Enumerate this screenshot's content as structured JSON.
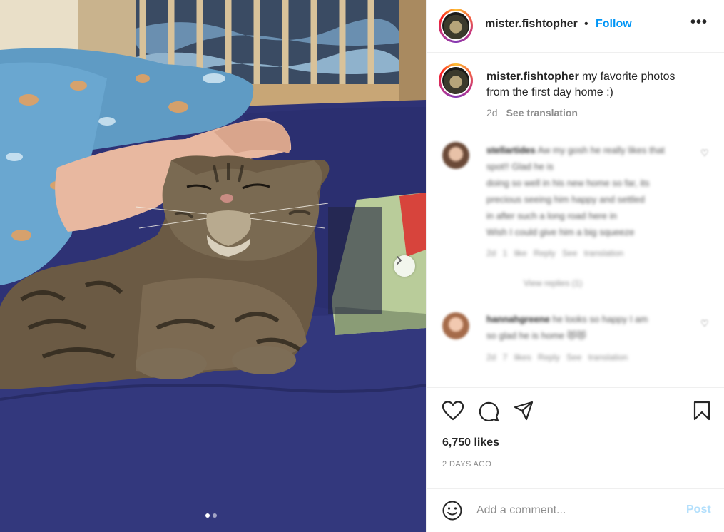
{
  "post": {
    "username": "mister.fishtopher",
    "follow_label": "Follow",
    "bullet": "•",
    "more_label": "•••",
    "caption_text": "my favorite photos from the first day home :)",
    "caption_age": "2d",
    "see_translation": "See translation",
    "likes": "6,750 likes",
    "posted_ago": "2 DAYS AGO",
    "comment_placeholder": "Add a comment...",
    "post_label": "Post",
    "carousel_index": 0,
    "carousel_count": 2
  },
  "comments": [
    {
      "username": "stellartides",
      "text_lines": [
        "Aw my gosh he really likes that spot!! Glad he is",
        "doing so well in his new home so far, its",
        "precious seeing him happy and settled",
        "in after such a long road here in",
        "Wish I could give him a big squeeze"
      ],
      "meta": "2d 1 like Reply See translation",
      "like_icon": "♡"
    },
    {
      "username": "hannahgreene",
      "text_lines": [
        "he looks so happy I am",
        "so glad he is home 😻😻"
      ],
      "meta": "2d 7 likes Reply See translation",
      "like_icon": "♡"
    }
  ],
  "view_replies": "View replies (1)",
  "colors": {
    "follow_blue": "#0095f6",
    "post_disabled": "#b2dffc",
    "muted": "#8e8e8e",
    "text": "#262626"
  },
  "icons": {
    "like": "heart-icon",
    "comment": "comment-bubble-icon",
    "share": "paper-plane-icon",
    "save": "bookmark-icon",
    "emoji": "smiley-icon",
    "next": "chevron-right-icon"
  }
}
